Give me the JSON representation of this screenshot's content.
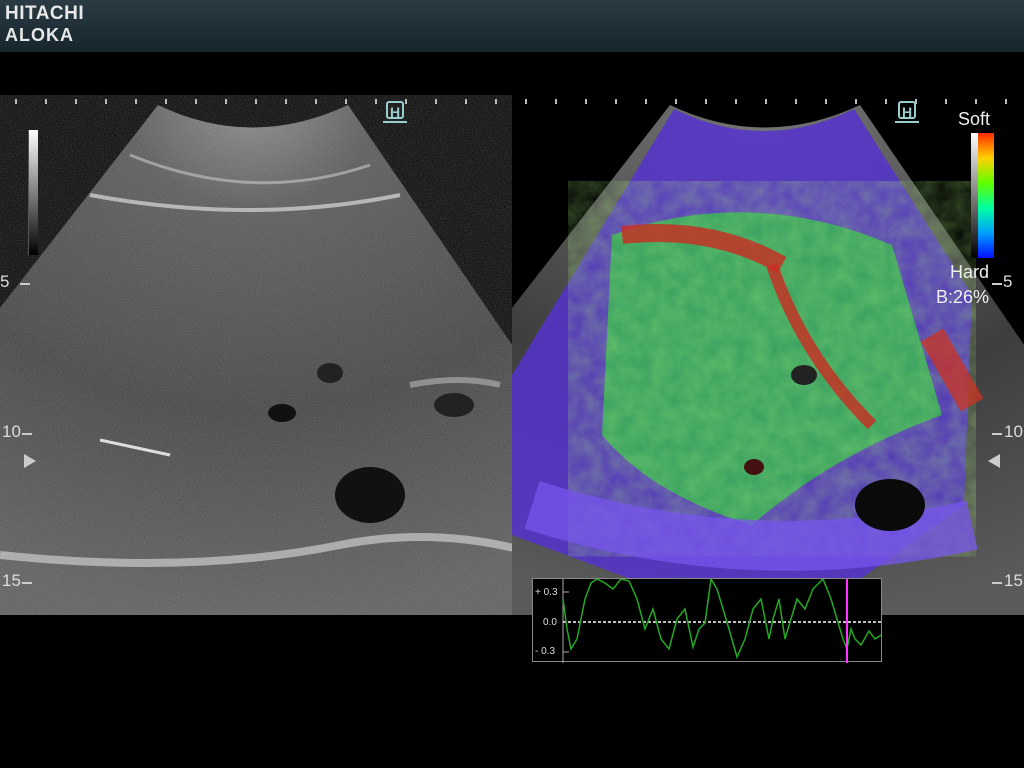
{
  "header": {
    "brand_line1": "HITACHI",
    "brand_line2": "ALOKA"
  },
  "markers": {
    "orientation_left": "H",
    "orientation_right": "H"
  },
  "depth_scale": {
    "left": [
      "5",
      "10",
      "15"
    ],
    "right": [
      "5",
      "10",
      "15"
    ]
  },
  "elasto_scale": {
    "soft_label": "Soft",
    "hard_label": "Hard",
    "b_ratio": "B:26%"
  },
  "strain_graph": {
    "label_pos": "+ 0.3",
    "label_zero": "0.0",
    "label_neg": "- 0.3",
    "line_color": "#22aa22",
    "cursor_color": "#ff33ff"
  },
  "colors": {
    "header_bg": "#1f2e35",
    "soft": "#ff2a00",
    "hard": "#0010ff"
  }
}
